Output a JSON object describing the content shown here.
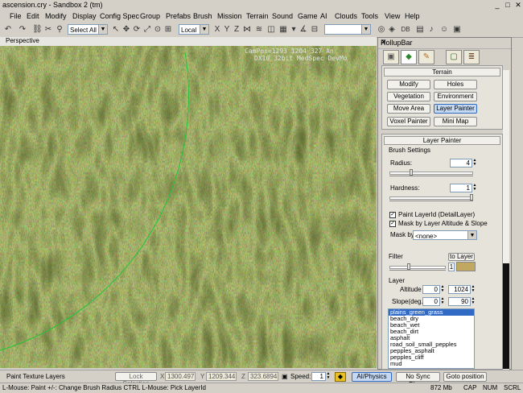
{
  "window": {
    "title": "ascension.cry - Sandbox 2 (tm)",
    "minimize": "_",
    "maximize": "□",
    "close": "✕"
  },
  "menu": [
    "File",
    "Edit",
    "Modify",
    "Display",
    "Config Spec",
    "Group",
    "Prefabs",
    "Brush",
    "Mission",
    "Terrain",
    "Sound",
    "Game",
    "AI",
    "Clouds",
    "Tools",
    "View",
    "Help"
  ],
  "toolbar": {
    "selection_combo": "Select All",
    "coord_combo": "Local",
    "search_combo": "",
    "db_label": "DB"
  },
  "viewport": {
    "label": "Perspective",
    "campos": "CamPos=1293 1204 327 An",
    "render_info": "DX10 32bit MedSpec DevMo"
  },
  "rollup": {
    "title": "RollupBar",
    "tabs": [
      "create-icon",
      "terrain-icon",
      "modify-icon",
      "display-icon",
      "layers-icon"
    ],
    "terrain_header": "Terrain",
    "terrain_buttons": [
      "Modify",
      "Holes",
      "Vegetation",
      "Environment",
      "Move Area",
      "Layer Painter",
      "Voxel Painter",
      "Mini Map"
    ],
    "layer_painter_header": "Layer Painter",
    "brush_settings": "Brush Settings",
    "radius_label": "Radius:",
    "radius_value": "4",
    "radius_fraction": 0.25,
    "hardness_label": "Hardness:",
    "hardness_value": "1",
    "hardness_fraction": 1.0,
    "paint_layerid": "Paint LayerId (DetailLayer)",
    "mask_altitude": "Mask by Layer Altitude & Slope",
    "mask_by_label": "Mask by",
    "mask_by_value": "<none>",
    "filter_label": "Filter",
    "to_layer_button": "to Layer",
    "filter_value": "1",
    "filter_color": "#c0a860",
    "layer_label": "Layer",
    "altitude_label": "Altitude",
    "altitude_min": "0",
    "altitude_max": "1024",
    "slope_label": "Slope(deg.)",
    "slope_min": "0",
    "slope_max": "90",
    "layers": [
      "plains_green_grass",
      "beach_dry",
      "beach_wet",
      "beach_dirt",
      "asphalt",
      "road_soil_small_pepples",
      "pepples_asphalt",
      "pepples_cliff",
      "mud"
    ],
    "selected_layer": "plains_green_grass"
  },
  "bottom_toolbar": {
    "mode": "Paint Texture Layers",
    "lock_selection": "Lock Selection",
    "x_label": "X",
    "x_value": "1300.497",
    "y_label": "Y",
    "y_value": "1209.344",
    "z_label": "Z",
    "z_value": "323.6894",
    "speed_label": "Speed:",
    "speed_value": "1",
    "ai_physics": "AI/Physics",
    "no_sync_player": "No Sync Player",
    "goto_position": "Goto position"
  },
  "status": {
    "hint": "L-Mouse: Paint   +/-: Change Brush Radius   CTRL L-Mouse: Pick LayerId",
    "memory": "872 Mb",
    "cap": "CAP",
    "num": "NUM",
    "scrl": "SCRL"
  },
  "colors": {
    "chrome": "#d4d0c8",
    "selection": "#316ac5",
    "grass_dark": "#2f3510",
    "grass_light": "#8a9a4a",
    "brush_circle": "#22c33a"
  }
}
